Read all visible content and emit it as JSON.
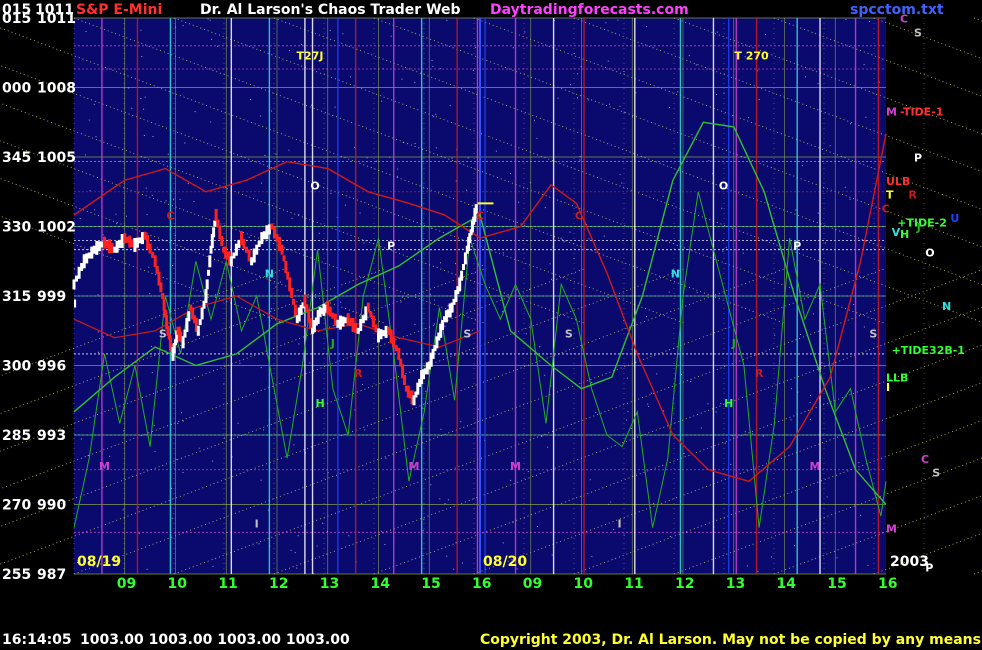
{
  "header": {
    "left_code": "015",
    "left_price": "1011",
    "symbol": "S&P E-Mini",
    "title": "Dr. Al Larson's Chaos Trader Web",
    "site": "Daytradingforecasts.com",
    "file": "spcctom.txt"
  },
  "status": {
    "time": "16:14:05",
    "ohlc": "1003.00 1003.00 1003.00 1003.00",
    "copyright": "Copyright 2003, Dr. Al Larson. May not be copied by any means."
  },
  "colors": {
    "background": "#000000",
    "plot_bg": "#0a0a6e",
    "price_up": "#ffffff",
    "price_down": "#ff2020",
    "tide_red": "#d01818",
    "tide_green": "#20b020",
    "grid_yellow": "#e8e860",
    "cyan": "#30e0e0",
    "magenta": "#d040d0",
    "label_text": "#ffffff",
    "date_yellow": "#ffff30",
    "hour_green": "#30ff30"
  },
  "chart_data": {
    "type": "line",
    "y_axis": {
      "codes": [
        "015",
        "000",
        "345",
        "330",
        "315",
        "300",
        "285",
        "270",
        "255"
      ],
      "prices": [
        1011,
        1008,
        1005,
        1002,
        999,
        996,
        993,
        990,
        987
      ],
      "ylim": [
        987,
        1011
      ]
    },
    "x_axis": {
      "hour_ticks": [
        "09",
        "10",
        "11",
        "12",
        "13",
        "14",
        "15",
        "16",
        "09",
        "10",
        "11",
        "12",
        "13",
        "14",
        "15",
        "16"
      ],
      "day_labels": [
        "08/19",
        "08/20"
      ],
      "year_label": "2003",
      "slots": 16
    },
    "price_series": [
      {
        "t": 0.0,
        "p": 999.5
      },
      {
        "t": 0.2,
        "p": 1000.5
      },
      {
        "t": 0.4,
        "p": 1001.0
      },
      {
        "t": 0.6,
        "p": 1001.3
      },
      {
        "t": 0.8,
        "p": 1001.0
      },
      {
        "t": 1.0,
        "p": 1001.5
      },
      {
        "t": 1.2,
        "p": 1001.2
      },
      {
        "t": 1.4,
        "p": 1001.6
      },
      {
        "t": 1.6,
        "p": 1000.5
      },
      {
        "t": 1.75,
        "p": 999.0
      },
      {
        "t": 1.85,
        "p": 997.5
      },
      {
        "t": 1.95,
        "p": 996.5
      },
      {
        "t": 2.05,
        "p": 997.5
      },
      {
        "t": 2.15,
        "p": 997.0
      },
      {
        "t": 2.3,
        "p": 998.5
      },
      {
        "t": 2.45,
        "p": 997.5
      },
      {
        "t": 2.6,
        "p": 999.0
      },
      {
        "t": 2.7,
        "p": 1001.0
      },
      {
        "t": 2.8,
        "p": 1002.5
      },
      {
        "t": 2.95,
        "p": 1001.0
      },
      {
        "t": 3.1,
        "p": 1000.5
      },
      {
        "t": 3.3,
        "p": 1001.5
      },
      {
        "t": 3.5,
        "p": 1000.5
      },
      {
        "t": 3.7,
        "p": 1001.5
      },
      {
        "t": 3.9,
        "p": 1002.0
      },
      {
        "t": 4.1,
        "p": 1001.0
      },
      {
        "t": 4.25,
        "p": 999.5
      },
      {
        "t": 4.4,
        "p": 998.0
      },
      {
        "t": 4.55,
        "p": 998.8
      },
      {
        "t": 4.7,
        "p": 997.5
      },
      {
        "t": 4.85,
        "p": 998.3
      },
      {
        "t": 5.0,
        "p": 998.5
      },
      {
        "t": 5.2,
        "p": 997.8
      },
      {
        "t": 5.4,
        "p": 998.0
      },
      {
        "t": 5.6,
        "p": 997.5
      },
      {
        "t": 5.8,
        "p": 998.5
      },
      {
        "t": 6.0,
        "p": 997.3
      },
      {
        "t": 6.2,
        "p": 997.5
      },
      {
        "t": 6.4,
        "p": 996.5
      },
      {
        "t": 6.55,
        "p": 995.0
      },
      {
        "t": 6.7,
        "p": 994.5
      },
      {
        "t": 6.85,
        "p": 995.5
      },
      {
        "t": 7.0,
        "p": 996.0
      },
      {
        "t": 7.15,
        "p": 997.0
      },
      {
        "t": 7.3,
        "p": 998.0
      },
      {
        "t": 7.45,
        "p": 998.5
      },
      {
        "t": 7.6,
        "p": 999.5
      },
      {
        "t": 7.75,
        "p": 1001.0
      },
      {
        "t": 7.85,
        "p": 1002.0
      },
      {
        "t": 7.95,
        "p": 1003.0
      }
    ],
    "red_tide": [
      {
        "t": 0.0,
        "p": 1002.5
      },
      {
        "t": 1.0,
        "p": 1004.0
      },
      {
        "t": 1.8,
        "p": 1004.5
      },
      {
        "t": 2.6,
        "p": 1003.5
      },
      {
        "t": 3.4,
        "p": 1004.0
      },
      {
        "t": 4.2,
        "p": 1004.8
      },
      {
        "t": 5.0,
        "p": 1004.5
      },
      {
        "t": 5.8,
        "p": 1003.5
      },
      {
        "t": 6.6,
        "p": 1003.0
      },
      {
        "t": 7.3,
        "p": 1002.5
      },
      {
        "t": 8.0,
        "p": 1001.5
      },
      {
        "t": 8.8,
        "p": 1002.0
      },
      {
        "t": 9.4,
        "p": 1003.8
      },
      {
        "t": 9.9,
        "p": 1003.0
      },
      {
        "t": 10.5,
        "p": 1000.0
      },
      {
        "t": 11.1,
        "p": 996.5
      },
      {
        "t": 11.8,
        "p": 993.0
      },
      {
        "t": 12.5,
        "p": 991.5
      },
      {
        "t": 13.3,
        "p": 991.0
      },
      {
        "t": 14.1,
        "p": 992.5
      },
      {
        "t": 14.9,
        "p": 995.5
      },
      {
        "t": 15.5,
        "p": 1000.5
      },
      {
        "t": 16.0,
        "p": 1006.0
      }
    ],
    "red_tide_2": [
      {
        "t": 0.0,
        "p": 998.0
      },
      {
        "t": 0.8,
        "p": 997.2
      },
      {
        "t": 1.6,
        "p": 997.5
      },
      {
        "t": 2.4,
        "p": 998.5
      },
      {
        "t": 3.2,
        "p": 999.0
      },
      {
        "t": 4.0,
        "p": 998.0
      },
      {
        "t": 4.8,
        "p": 997.5
      },
      {
        "t": 5.6,
        "p": 997.8
      },
      {
        "t": 6.4,
        "p": 997.2
      },
      {
        "t": 7.2,
        "p": 996.8
      },
      {
        "t": 8.0,
        "p": 997.5
      }
    ],
    "green_tide": [
      {
        "t": 0.0,
        "p": 994.0
      },
      {
        "t": 0.8,
        "p": 995.5
      },
      {
        "t": 1.6,
        "p": 996.8
      },
      {
        "t": 2.4,
        "p": 996.0
      },
      {
        "t": 3.2,
        "p": 996.5
      },
      {
        "t": 4.0,
        "p": 997.8
      },
      {
        "t": 4.8,
        "p": 998.5
      },
      {
        "t": 5.6,
        "p": 999.5
      },
      {
        "t": 6.4,
        "p": 1000.3
      },
      {
        "t": 7.2,
        "p": 1001.5
      },
      {
        "t": 8.0,
        "p": 1002.5
      },
      {
        "t": 8.6,
        "p": 997.5
      },
      {
        "t": 9.4,
        "p": 996.0
      },
      {
        "t": 10.0,
        "p": 995.0
      },
      {
        "t": 10.6,
        "p": 995.5
      },
      {
        "t": 11.2,
        "p": 999.0
      },
      {
        "t": 11.8,
        "p": 1004.0
      },
      {
        "t": 12.4,
        "p": 1006.5
      },
      {
        "t": 13.0,
        "p": 1006.3
      },
      {
        "t": 13.6,
        "p": 1003.5
      },
      {
        "t": 14.2,
        "p": 999.0
      },
      {
        "t": 14.8,
        "p": 995.0
      },
      {
        "t": 15.4,
        "p": 991.5
      },
      {
        "t": 16.0,
        "p": 990.0
      }
    ],
    "green_noise": [
      {
        "t": 0.0,
        "p": 989.0
      },
      {
        "t": 0.3,
        "p": 992.0
      },
      {
        "t": 0.6,
        "p": 996.5
      },
      {
        "t": 0.9,
        "p": 993.5
      },
      {
        "t": 1.2,
        "p": 996.0
      },
      {
        "t": 1.5,
        "p": 992.5
      },
      {
        "t": 1.8,
        "p": 999.0
      },
      {
        "t": 2.1,
        "p": 996.5
      },
      {
        "t": 2.4,
        "p": 1000.5
      },
      {
        "t": 2.7,
        "p": 998.0
      },
      {
        "t": 3.0,
        "p": 1000.5
      },
      {
        "t": 3.3,
        "p": 997.5
      },
      {
        "t": 3.6,
        "p": 999.0
      },
      {
        "t": 3.9,
        "p": 995.5
      },
      {
        "t": 4.2,
        "p": 992.0
      },
      {
        "t": 4.5,
        "p": 996.0
      },
      {
        "t": 4.8,
        "p": 1001.0
      },
      {
        "t": 5.1,
        "p": 995.0
      },
      {
        "t": 5.4,
        "p": 993.0
      },
      {
        "t": 5.7,
        "p": 999.0
      },
      {
        "t": 6.0,
        "p": 1001.5
      },
      {
        "t": 6.3,
        "p": 996.5
      },
      {
        "t": 6.6,
        "p": 991.0
      },
      {
        "t": 6.9,
        "p": 994.0
      },
      {
        "t": 7.2,
        "p": 998.5
      },
      {
        "t": 7.5,
        "p": 994.5
      },
      {
        "t": 7.8,
        "p": 1001.5
      },
      {
        "t": 8.1,
        "p": 999.5
      },
      {
        "t": 8.4,
        "p": 998.0
      },
      {
        "t": 8.7,
        "p": 999.5
      },
      {
        "t": 9.0,
        "p": 998.0
      },
      {
        "t": 9.3,
        "p": 993.5
      },
      {
        "t": 9.6,
        "p": 999.5
      },
      {
        "t": 9.9,
        "p": 998.0
      },
      {
        "t": 10.2,
        "p": 995.0
      },
      {
        "t": 10.5,
        "p": 993.0
      },
      {
        "t": 10.8,
        "p": 992.5
      },
      {
        "t": 11.1,
        "p": 994.0
      },
      {
        "t": 11.4,
        "p": 989.0
      },
      {
        "t": 11.7,
        "p": 992.0
      },
      {
        "t": 12.0,
        "p": 999.0
      },
      {
        "t": 12.3,
        "p": 1003.5
      },
      {
        "t": 12.6,
        "p": 1001.0
      },
      {
        "t": 12.9,
        "p": 998.5
      },
      {
        "t": 13.2,
        "p": 996.0
      },
      {
        "t": 13.5,
        "p": 989.0
      },
      {
        "t": 13.8,
        "p": 993.5
      },
      {
        "t": 14.1,
        "p": 1001.5
      },
      {
        "t": 14.4,
        "p": 998.0
      },
      {
        "t": 14.7,
        "p": 999.5
      },
      {
        "t": 15.0,
        "p": 994.0
      },
      {
        "t": 15.3,
        "p": 995.0
      },
      {
        "t": 15.6,
        "p": 992.0
      },
      {
        "t": 15.9,
        "p": 989.5
      },
      {
        "t": 16.0,
        "p": 991.0
      }
    ],
    "flux_lines": [
      {
        "t": 0.55,
        "color": "#d040d0"
      },
      {
        "t": 1.25,
        "color": "#d01818"
      },
      {
        "t": 1.9,
        "color": "#30e0e0"
      },
      {
        "t": 3.1,
        "color": "#ffffff"
      },
      {
        "t": 3.85,
        "color": "#30e0e0"
      },
      {
        "t": 4.55,
        "color": "#ffffff"
      },
      {
        "t": 4.7,
        "color": "#ffffff"
      },
      {
        "t": 5.2,
        "color": "#2040ff"
      },
      {
        "t": 5.55,
        "color": "#d01818"
      },
      {
        "t": 6.3,
        "color": "#d040d0"
      },
      {
        "t": 6.85,
        "color": "#30e0e0"
      },
      {
        "t": 7.55,
        "color": "#d01818"
      },
      {
        "t": 7.95,
        "color": "#d040d0"
      },
      {
        "t": 8.1,
        "color": "#2040ff"
      },
      {
        "t": 8.7,
        "color": "#d040d0"
      },
      {
        "t": 9.45,
        "color": "#ffffff"
      },
      {
        "t": 10.05,
        "color": "#d01818"
      },
      {
        "t": 11.05,
        "color": "#ffffff"
      },
      {
        "t": 11.95,
        "color": "#30e0e0"
      },
      {
        "t": 12.6,
        "color": "#ffffff"
      },
      {
        "t": 12.9,
        "color": "#2040ff"
      },
      {
        "t": 13.05,
        "color": "#d040d0"
      },
      {
        "t": 13.45,
        "color": "#d01818"
      },
      {
        "t": 14.25,
        "color": "#30e0e0"
      },
      {
        "t": 14.7,
        "color": "#ffffff"
      },
      {
        "t": 15.4,
        "color": "#d040d0"
      },
      {
        "t": 15.85,
        "color": "#d01818"
      }
    ],
    "pivot_lines": [
      {
        "p": 1009.8,
        "color": "#d040d0"
      },
      {
        "p": 1008.8,
        "color": "#d040d0"
      },
      {
        "p": 1004.8,
        "color": "#30e0e0"
      },
      {
        "p": 1003.5,
        "color": "#d01818"
      },
      {
        "p": 1002.0,
        "color": "#30e0e0"
      },
      {
        "p": 1001.4,
        "color": "#ffffff"
      },
      {
        "p": 1001.0,
        "color": "#ffffff"
      },
      {
        "p": 999.0,
        "color": "#30e0e0"
      },
      {
        "p": 996.5,
        "color": "#ffffff"
      },
      {
        "p": 993.0,
        "color": "#30e0e0"
      },
      {
        "p": 991.5,
        "color": "#d040d0"
      },
      {
        "p": 988.8,
        "color": "#d040d0"
      }
    ],
    "chart_labels": [
      {
        "text": "T27J",
        "t": 4.65,
        "p": 1009.2,
        "color": "#ffff30"
      },
      {
        "text": "T 270",
        "t": 13.35,
        "p": 1009.2,
        "color": "#ffff30"
      },
      {
        "text": "O",
        "t": 4.75,
        "p": 1003.6,
        "color": "#ffffff"
      },
      {
        "text": "O",
        "t": 12.8,
        "p": 1003.6,
        "color": "#ffffff"
      },
      {
        "text": "C",
        "t": 1.9,
        "p": 1002.3,
        "color": "#d01818"
      },
      {
        "text": "C",
        "t": 8.0,
        "p": 1002.3,
        "color": "#d01818"
      },
      {
        "text": "C",
        "t": 9.95,
        "p": 1002.3,
        "color": "#d01818"
      },
      {
        "text": "P",
        "t": 6.25,
        "p": 1001.0,
        "color": "#ffffff"
      },
      {
        "text": "P",
        "t": 14.25,
        "p": 1001.0,
        "color": "#ffffff"
      },
      {
        "text": "N",
        "t": 3.85,
        "p": 999.8,
        "color": "#30e0e0"
      },
      {
        "text": "N",
        "t": 11.85,
        "p": 999.8,
        "color": "#30e0e0"
      },
      {
        "text": "S",
        "t": 1.75,
        "p": 997.2,
        "color": "#c0c0c0"
      },
      {
        "text": "S",
        "t": 7.75,
        "p": 997.2,
        "color": "#c0c0c0"
      },
      {
        "text": "S",
        "t": 9.75,
        "p": 997.2,
        "color": "#c0c0c0"
      },
      {
        "text": "S",
        "t": 15.75,
        "p": 997.2,
        "color": "#c0c0c0"
      },
      {
        "text": "J",
        "t": 5.1,
        "p": 996.8,
        "color": "#20b020"
      },
      {
        "text": "J",
        "t": 13.0,
        "p": 996.8,
        "color": "#20b020"
      },
      {
        "text": "R",
        "t": 5.6,
        "p": 995.5,
        "color": "#d01818"
      },
      {
        "text": "R",
        "t": 13.5,
        "p": 995.5,
        "color": "#d01818"
      },
      {
        "text": "H",
        "t": 4.85,
        "p": 994.2,
        "color": "#30ff30"
      },
      {
        "text": "H",
        "t": 12.9,
        "p": 994.2,
        "color": "#30ff30"
      },
      {
        "text": "M",
        "t": 0.6,
        "p": 991.5,
        "color": "#d040d0"
      },
      {
        "text": "M",
        "t": 6.7,
        "p": 991.5,
        "color": "#d040d0"
      },
      {
        "text": "M",
        "t": 8.7,
        "p": 991.5,
        "color": "#d040d0"
      },
      {
        "text": "M",
        "t": 14.6,
        "p": 991.5,
        "color": "#d040d0"
      },
      {
        "text": "I",
        "t": 3.6,
        "p": 989.0,
        "color": "#c0c0c0"
      },
      {
        "text": "I",
        "t": 10.75,
        "p": 989.0,
        "color": "#c0c0c0"
      },
      {
        "text": "I",
        "t": 0.02,
        "p": 998.5,
        "color": "#ffffff"
      }
    ],
    "right_labels": [
      {
        "text": "C",
        "p": 1010.8,
        "color": "#d040d0",
        "col": 1
      },
      {
        "text": "S",
        "p": 1010.2,
        "color": "#c0c0c0",
        "col": 2
      },
      {
        "text": "M",
        "p": 1006.8,
        "color": "#d040d0",
        "col": 0
      },
      {
        "text": "-TIDE-1",
        "p": 1006.8,
        "color": "#ff3030",
        "col": 1
      },
      {
        "text": "P",
        "p": 1004.8,
        "color": "#ffffff",
        "col": 2
      },
      {
        "text": "ULB",
        "p": 1003.8,
        "color": "#ff3030",
        "col": 0
      },
      {
        "text": "T",
        "p": 1003.2,
        "color": "#ffff30",
        "col": 0
      },
      {
        "text": "R",
        "p": 1003.2,
        "color": "#d01818",
        "col": 1.6
      },
      {
        "text": "C",
        "p": 1002.6,
        "color": "#d01818",
        "col": -0.3
      },
      {
        "text": "+TIDE-2",
        "p": 1002.0,
        "color": "#30ff30",
        "col": 0.8
      },
      {
        "text": "U",
        "p": 1002.2,
        "color": "#2040ff",
        "col": 4.6
      },
      {
        "text": "V",
        "p": 1001.6,
        "color": "#30e0e0",
        "col": 0.4
      },
      {
        "text": "H",
        "p": 1001.5,
        "color": "#30ff30",
        "col": 1.0
      },
      {
        "text": "J",
        "p": 1001.8,
        "color": "#20b020",
        "col": 2.2
      },
      {
        "text": "O",
        "p": 1000.7,
        "color": "#ffffff",
        "col": 2.8
      },
      {
        "text": "N",
        "p": 998.4,
        "color": "#30e0e0",
        "col": 4.0
      },
      {
        "text": "+TIDE32B-1",
        "p": 996.5,
        "color": "#30ff30",
        "col": 0.4
      },
      {
        "text": "LLB",
        "p": 995.3,
        "color": "#30ff30",
        "col": 0
      },
      {
        "text": "I",
        "p": 994.9,
        "color": "#ffff30",
        "col": 0
      },
      {
        "text": "C",
        "p": 991.8,
        "color": "#d040d0",
        "col": 2.5
      },
      {
        "text": "S",
        "p": 991.2,
        "color": "#c0c0c0",
        "col": 3.3
      },
      {
        "text": "M",
        "p": 988.8,
        "color": "#d040d0",
        "col": 0
      },
      {
        "text": "P",
        "p": 987.1,
        "color": "#ffffff",
        "col": 2.8
      }
    ]
  }
}
